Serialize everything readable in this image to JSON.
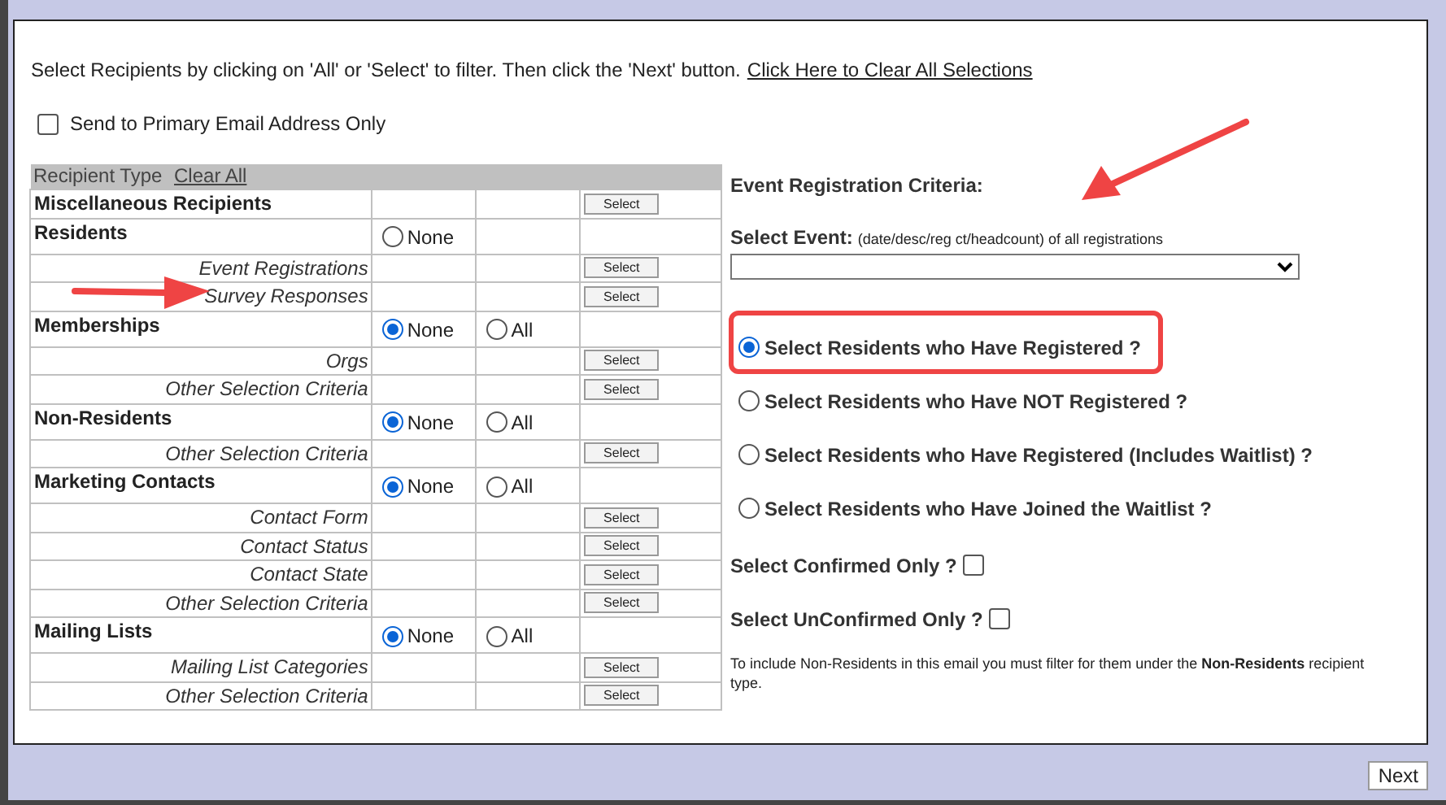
{
  "instructions": {
    "text": "Select Recipients by clicking on 'All' or 'Select' to filter. Then click the 'Next' button.",
    "link": "Click Here to Clear All Selections"
  },
  "primary_email_only": {
    "label": "Send to Primary Email Address Only",
    "checked": false
  },
  "recipients_table": {
    "header": "Recipient Type",
    "clear_link": "Clear All",
    "rows": [
      {
        "kind": "group",
        "label": "Miscellaneous Recipients",
        "options": [],
        "button": "Select"
      },
      {
        "kind": "group",
        "label": "Residents",
        "options": [
          {
            "label": "None",
            "selected": false
          }
        ]
      },
      {
        "kind": "sub",
        "label": "Event Registrations",
        "button": "Select"
      },
      {
        "kind": "sub",
        "label": "Survey Responses",
        "button": "Select"
      },
      {
        "kind": "group",
        "label": "Memberships",
        "options": [
          {
            "label": "None",
            "selected": true
          },
          {
            "label": "All",
            "selected": false
          }
        ]
      },
      {
        "kind": "sub",
        "label": "Orgs",
        "button": "Select"
      },
      {
        "kind": "sub",
        "label": "Other Selection Criteria",
        "button": "Select"
      },
      {
        "kind": "group",
        "label": "Non-Residents",
        "options": [
          {
            "label": "None",
            "selected": true
          },
          {
            "label": "All",
            "selected": false
          }
        ]
      },
      {
        "kind": "sub",
        "label": "Other Selection Criteria",
        "button": "Select"
      },
      {
        "kind": "group",
        "label": "Marketing Contacts",
        "options": [
          {
            "label": "None",
            "selected": true
          },
          {
            "label": "All",
            "selected": false
          }
        ]
      },
      {
        "kind": "sub",
        "label": "Contact Form",
        "button": "Select"
      },
      {
        "kind": "sub",
        "label": "Contact Status",
        "button": "Select"
      },
      {
        "kind": "sub",
        "label": "Contact State",
        "button": "Select"
      },
      {
        "kind": "sub",
        "label": "Other Selection Criteria",
        "button": "Select"
      },
      {
        "kind": "group",
        "label": "Mailing Lists",
        "options": [
          {
            "label": "None",
            "selected": true
          },
          {
            "label": "All",
            "selected": false
          }
        ]
      },
      {
        "kind": "sub",
        "label": "Mailing List Categories",
        "button": "Select"
      },
      {
        "kind": "sub",
        "label": "Other Selection Criteria",
        "button": "Select"
      }
    ]
  },
  "criteria": {
    "title": "Event Registration Criteria:",
    "event_label": "Select Event:",
    "event_hint": "(date/desc/reg ct/headcount) of all registrations",
    "options": [
      {
        "label": "Select Residents who Have Registered ?",
        "selected": true
      },
      {
        "label": "Select Residents who Have NOT Registered ?",
        "selected": false
      },
      {
        "label": "Select Residents who Have Registered (Includes Waitlist) ?",
        "selected": false
      },
      {
        "label": "Select Residents who Have Joined the Waitlist ?",
        "selected": false
      }
    ],
    "checks": [
      {
        "label": "Select Confirmed Only ?",
        "checked": false
      },
      {
        "label": "Select UnConfirmed Only ?",
        "checked": false
      }
    ],
    "note": "To include Non-Residents in this email you must filter for them under the **Non-Residents** recipient type."
  },
  "next_button": "Next"
}
